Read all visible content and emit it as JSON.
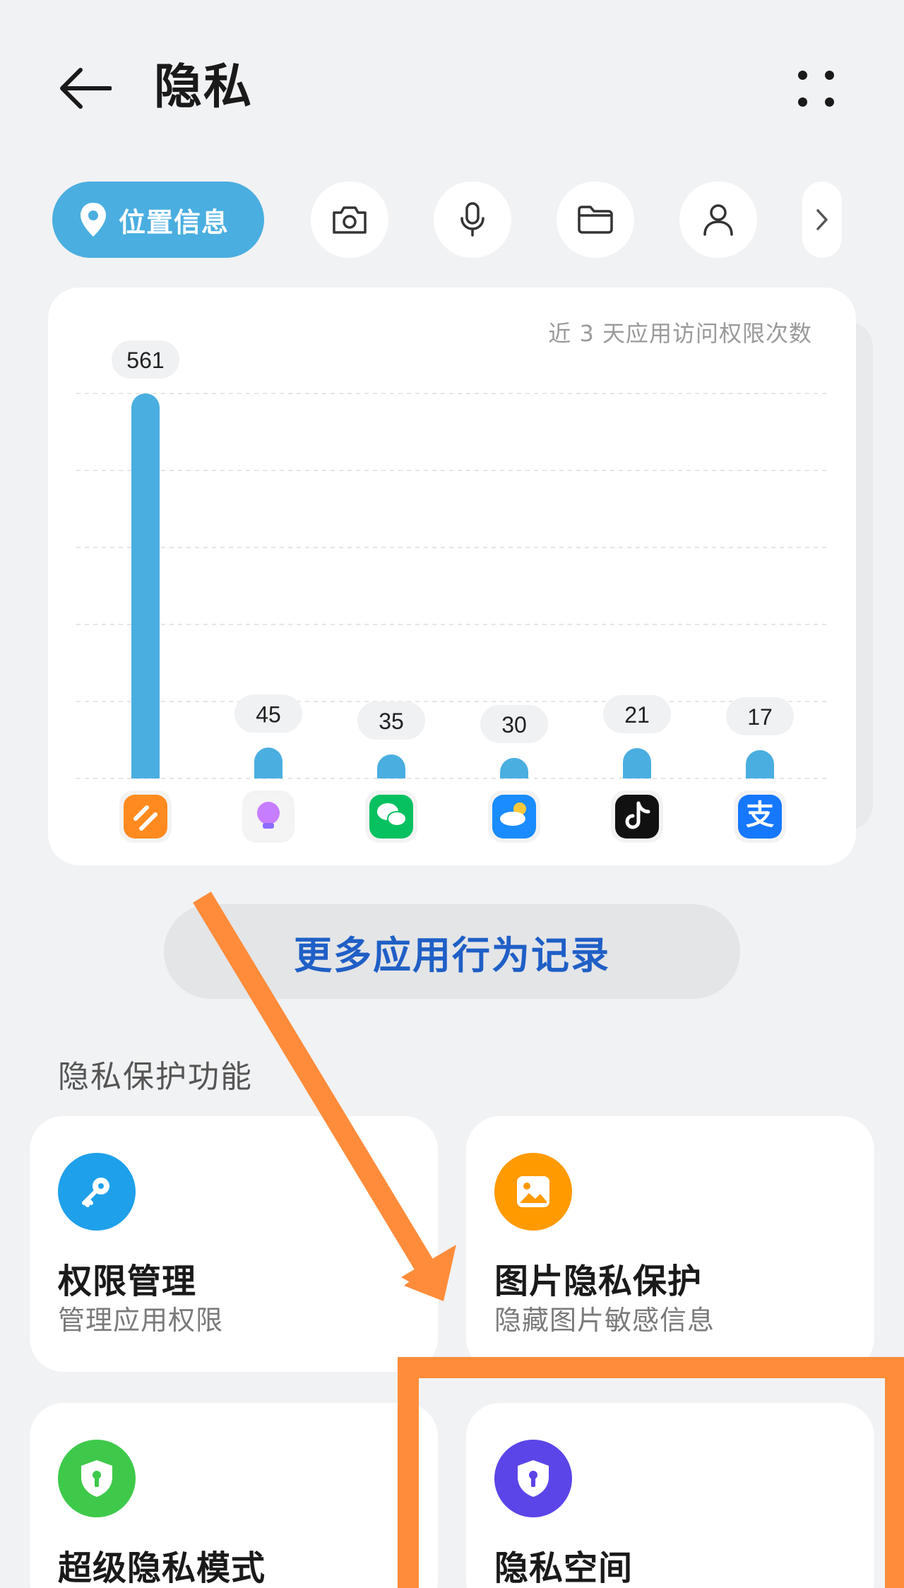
{
  "header": {
    "title": "隐私"
  },
  "filters": {
    "active_label": "位置信息",
    "icons": [
      "camera-icon",
      "microphone-icon",
      "folder-icon",
      "contacts-icon"
    ]
  },
  "chart_card": {
    "caption": "近 3 天应用访问权限次数"
  },
  "chart_data": {
    "type": "bar",
    "categories": [
      "华为运动健康",
      "智慧助手",
      "微信",
      "天气",
      "抖音",
      "支付宝"
    ],
    "values": [
      561,
      45,
      35,
      30,
      21,
      17
    ],
    "value_labels": [
      "561",
      "45",
      "35",
      "30",
      "21",
      "17"
    ],
    "title": "近 3 天应用访问权限次数",
    "xlabel": "",
    "ylabel": "",
    "ylim": [
      0,
      561
    ],
    "grid": true,
    "bar_color": "#4aaee0",
    "app_icon_colors": [
      "#ff8a1f",
      "#f4f4f4",
      "#07c160",
      "#1a8cff",
      "#111111",
      "#1677ff"
    ]
  },
  "more_records_label": "更多应用行为记录",
  "section_label": "隐私保护功能",
  "features": [
    {
      "title": "权限管理",
      "subtitle": "管理应用权限",
      "icon": "key-icon",
      "color": "#1fa0ea"
    },
    {
      "title": "图片隐私保护",
      "subtitle": "隐藏图片敏感信息",
      "icon": "image-icon",
      "color": "#ff9a00"
    },
    {
      "title": "超级隐私模式",
      "subtitle": "",
      "icon": "shield-icon",
      "color": "#3ec94a"
    },
    {
      "title": "隐私空间",
      "subtitle": "",
      "icon": "lock-shield-icon",
      "color": "#5b45e8"
    }
  ],
  "annotation_color": "#ff8c3a"
}
